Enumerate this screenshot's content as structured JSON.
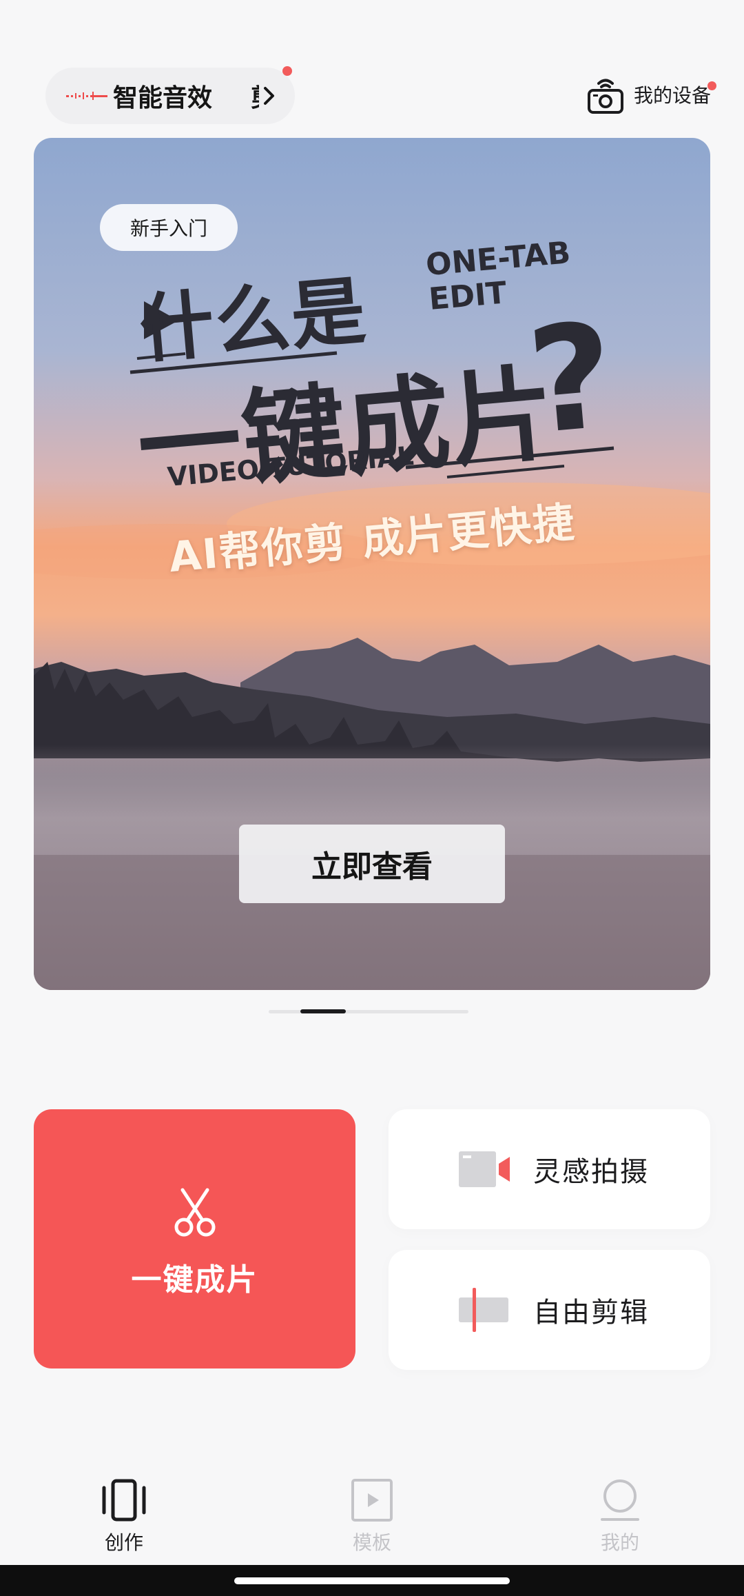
{
  "top_bar": {
    "feature_label": "智能音效",
    "next_feature_clip": "剪",
    "device_label": "我的设备"
  },
  "banner": {
    "tag": "新手入门",
    "headline_line1": "什么是",
    "headline_english": [
      "ONE-TAB",
      "EDIT"
    ],
    "headline_line2": "一键成片",
    "headline_question": "?",
    "subtitle_en": "VIDEO TUTORIAL",
    "slogan": "AI帮你剪  成片更快捷",
    "button_label": "立即查看"
  },
  "pager": {
    "total": 5,
    "current": 1
  },
  "actions": {
    "primary_label": "一键成片",
    "inspire_label": "灵感拍摄",
    "free_edit_label": "自由剪辑"
  },
  "nav": {
    "items": [
      {
        "label": "创作",
        "icon": "create-icon",
        "active": true
      },
      {
        "label": "模板",
        "icon": "template-icon",
        "active": false
      },
      {
        "label": "我的",
        "icon": "profile-icon",
        "active": false
      }
    ]
  },
  "colors": {
    "accent": "#f55656",
    "badge": "#f25b5b",
    "background": "#f7f7f8",
    "headline": "#2b2b34"
  }
}
